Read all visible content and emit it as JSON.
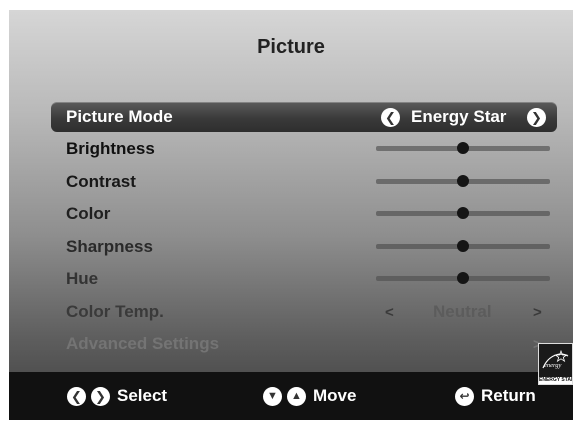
{
  "screen": {
    "title": "Picture"
  },
  "picture_mode": {
    "label": "Picture Mode",
    "value": "Energy Star",
    "left_icon": "chevron-left-circle-icon",
    "right_icon": "chevron-right-circle-icon"
  },
  "sliders": [
    {
      "label": "Brightness",
      "level": 0.5
    },
    {
      "label": "Contrast",
      "level": 0.5
    },
    {
      "label": "Color",
      "level": 0.5
    },
    {
      "label": "Sharpness",
      "level": 0.5
    },
    {
      "label": "Hue",
      "level": 0.5
    }
  ],
  "color_temp": {
    "label": "Color Temp.",
    "value": "Neutral",
    "left_arrow": "<",
    "right_arrow": ">"
  },
  "advanced": {
    "label": "Advanced Settings",
    "arrow": ">"
  },
  "energy_star_badge": {
    "script": "energy",
    "caption": "ENERGY STAR",
    "icon": "energy-star-logo-icon"
  },
  "footer": {
    "select_label": "Select",
    "move_label": "Move",
    "return_label": "Return",
    "select_icons": [
      "chevron-left-circle-icon",
      "chevron-right-circle-icon"
    ],
    "move_icons": [
      "chevron-down-circle-icon",
      "chevron-up-circle-icon"
    ],
    "return_icon": "return-circle-icon"
  },
  "colors": {
    "selected_text": "#ffffff",
    "footer_bg": "#111111",
    "text_fade": [
      "#111111",
      "#181818",
      "#202020",
      "#2a2a2a",
      "#333333",
      "#3a3a3a",
      "#5c5c5c",
      "#747474"
    ],
    "track_fade": [
      "#707070",
      "#6b6b6b",
      "#676767",
      "#626262",
      "#5e5e5e"
    ]
  }
}
